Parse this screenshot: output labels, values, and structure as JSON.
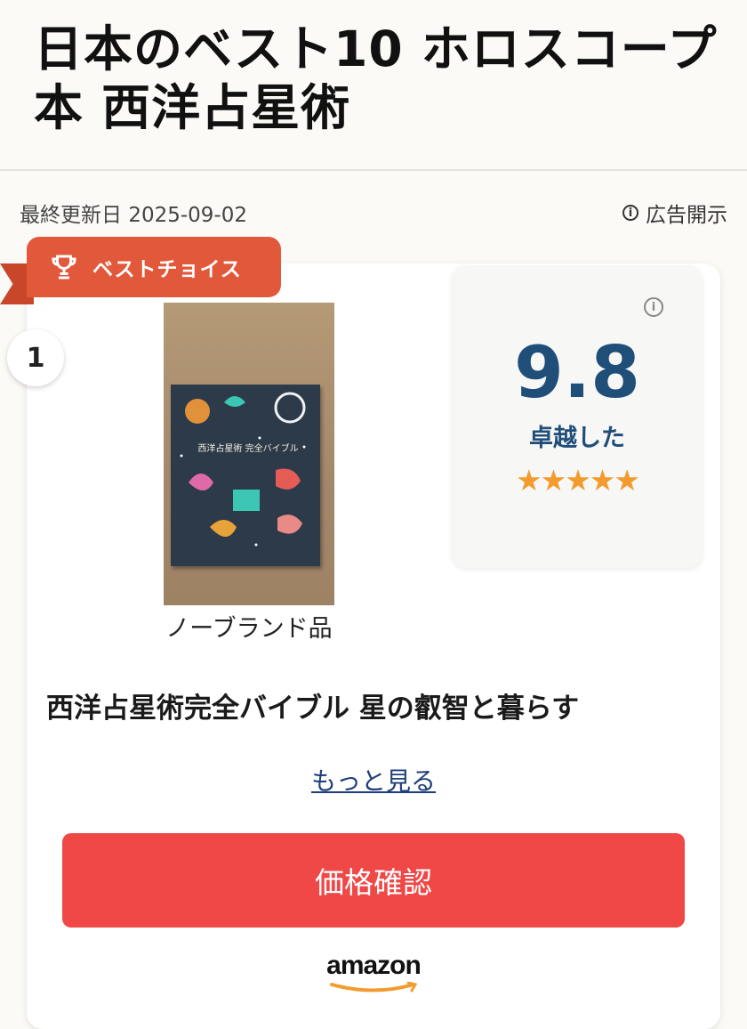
{
  "page": {
    "title": "日本のベスト10 ホロスコープ 本 西洋占星術",
    "updated_label": "最終更新日",
    "updated_date": "2025-09-02",
    "ad_disclosure": "広告開示"
  },
  "product": {
    "badge": "ベストチョイス",
    "rank": "1",
    "brand": "ノーブランド品",
    "book_cover_text": "西洋占星術 完全バイブル",
    "score": "9.8",
    "score_label": "卓越した",
    "stars": "★★★★★",
    "rating_stars": 5,
    "title": "西洋占星術完全バイブル 星の叡智と暮らす",
    "more_link": "もっと見る",
    "price_button": "価格確認",
    "store": "amazon"
  },
  "colors": {
    "badge": "#e2583a",
    "score": "#1f4e79",
    "stars": "#f39b2f",
    "button": "#f04747",
    "link": "#1f3e78"
  }
}
